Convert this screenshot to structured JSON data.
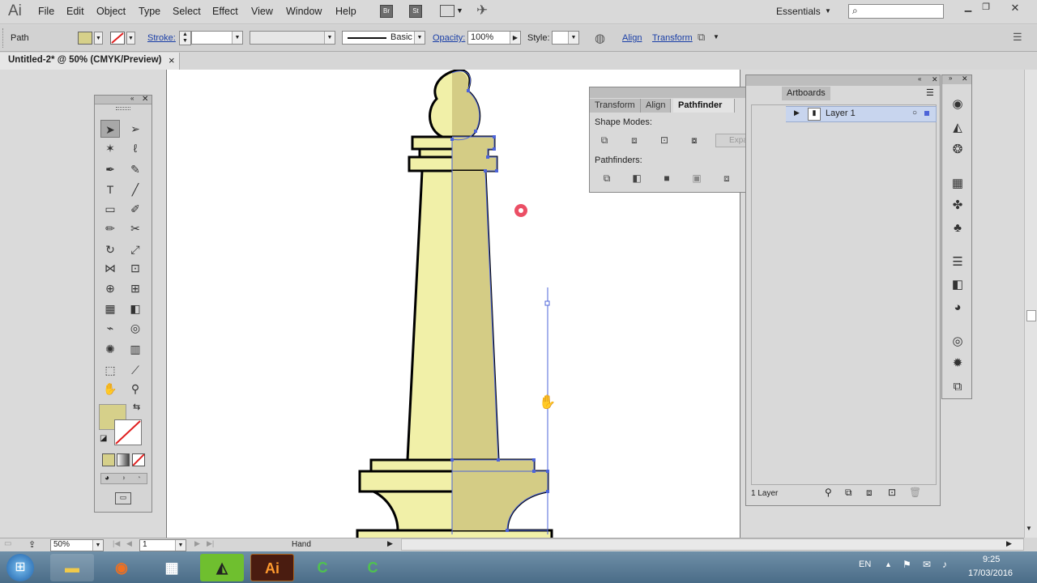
{
  "app": {
    "logo": "Ai",
    "workspace": "Essentials",
    "bridge_label": "Br",
    "stock_label": "St"
  },
  "menu": [
    "File",
    "Edit",
    "Object",
    "Type",
    "Select",
    "Effect",
    "View",
    "Window",
    "Help"
  ],
  "options_bar": {
    "selection_type": "Path",
    "fill_color": "#d6d08a",
    "stroke_label": "Stroke:",
    "stroke_style": "Basic",
    "opacity_label": "Opacity:",
    "opacity_value": "100%",
    "style_label": "Style:",
    "align_link": "Align",
    "transform_link": "Transform"
  },
  "document_tab": {
    "title": "Untitled-2* @ 50% (CMYK/Preview)",
    "close": "×"
  },
  "pathfinder_panel": {
    "tabs": [
      "Transform",
      "Align",
      "Pathfinder"
    ],
    "active_tab": "Pathfinder",
    "shape_modes_label": "Shape Modes:",
    "expand_label": "Expand",
    "pathfinders_label": "Pathfinders:"
  },
  "layers_panel": {
    "tab_label": "Artboards",
    "layer_name": "Layer 1",
    "count_label": "1 Layer"
  },
  "status_bar": {
    "zoom": "50%",
    "artboard_number": "1",
    "current_tool": "Hand"
  },
  "colors": {
    "fill_light": "#f1f0a8",
    "fill_shadow": "#d4cc85",
    "selection": "#4d64d8",
    "accent_dot": "#e8304a"
  },
  "taskbar": {
    "language": "EN",
    "time": "9:25",
    "date": "17/03/2016",
    "ai_label": "Ai"
  }
}
